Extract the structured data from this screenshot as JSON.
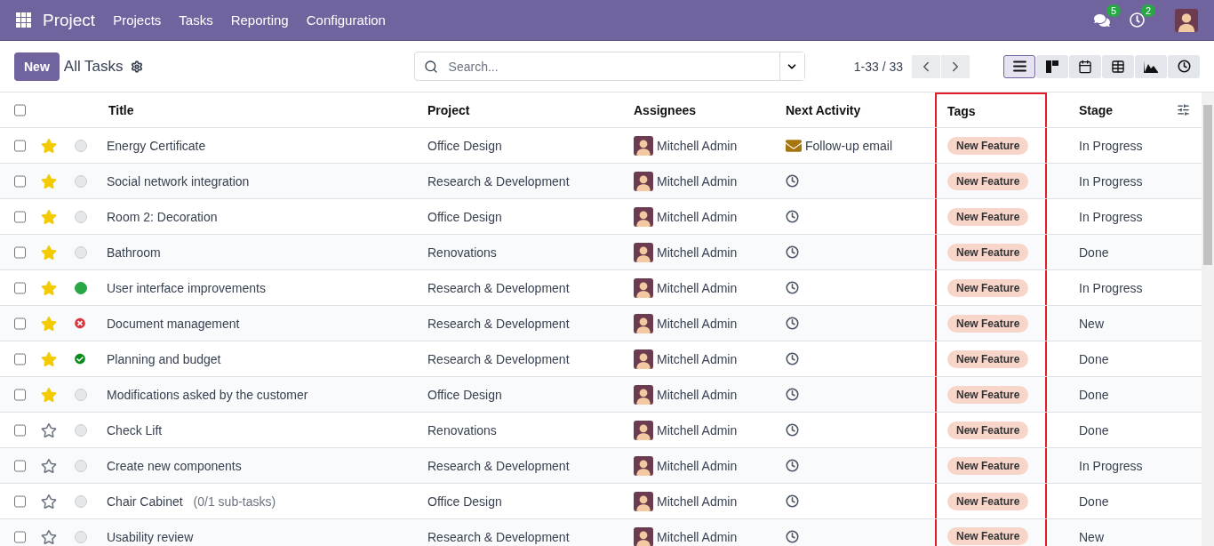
{
  "navbar": {
    "app_name": "Project",
    "menu": [
      "Projects",
      "Tasks",
      "Reporting",
      "Configuration"
    ],
    "messages_badge": "5",
    "activities_badge": "2"
  },
  "control_panel": {
    "new_button": "New",
    "title": "All Tasks",
    "search": {
      "placeholder": "Search..."
    },
    "pager": "1-33 / 33",
    "views": [
      {
        "kind": "list",
        "selected": true
      },
      {
        "kind": "kanban",
        "selected": false
      },
      {
        "kind": "calendar",
        "selected": false
      },
      {
        "kind": "pivot",
        "selected": false
      },
      {
        "kind": "graph",
        "selected": false
      },
      {
        "kind": "activity",
        "selected": false
      }
    ]
  },
  "table": {
    "all_selected": false,
    "columns": [
      {
        "label": "Title",
        "highlighted": false
      },
      {
        "label": "Project",
        "highlighted": false
      },
      {
        "label": "Assignees",
        "highlighted": false
      },
      {
        "label": "Next Activity",
        "highlighted": false
      },
      {
        "label": "Tags",
        "highlighted": true
      },
      {
        "label": "Stage",
        "highlighted": false
      }
    ],
    "rows": [
      {
        "checked": false,
        "starred": true,
        "status": {
          "kind": "normal"
        },
        "title": "Energy Certificate",
        "project": "Office Design",
        "assignee": "Mitchell Admin",
        "activity": {
          "kind": "email",
          "text": "Follow-up email"
        },
        "tag": "New Feature",
        "stage": "In Progress"
      },
      {
        "checked": false,
        "starred": true,
        "status": {
          "kind": "normal"
        },
        "title": "Social network integration",
        "project": "Research & Development",
        "assignee": "Mitchell Admin",
        "activity": {
          "kind": "none"
        },
        "tag": "New Feature",
        "stage": "In Progress"
      },
      {
        "checked": false,
        "starred": true,
        "status": {
          "kind": "normal"
        },
        "title": "Room 2: Decoration",
        "project": "Office Design",
        "assignee": "Mitchell Admin",
        "activity": {
          "kind": "none"
        },
        "tag": "New Feature",
        "stage": "In Progress"
      },
      {
        "checked": false,
        "starred": true,
        "status": {
          "kind": "normal"
        },
        "title": "Bathroom",
        "project": "Renovations",
        "assignee": "Mitchell Admin",
        "activity": {
          "kind": "none"
        },
        "tag": "New Feature",
        "stage": "Done"
      },
      {
        "checked": false,
        "starred": true,
        "status": {
          "kind": "ready"
        },
        "title": "User interface improvements",
        "project": "Research & Development",
        "assignee": "Mitchell Admin",
        "activity": {
          "kind": "none"
        },
        "tag": "New Feature",
        "stage": "In Progress"
      },
      {
        "checked": false,
        "starred": true,
        "status": {
          "kind": "blocked"
        },
        "title": "Document management",
        "project": "Research & Development",
        "assignee": "Mitchell Admin",
        "activity": {
          "kind": "none"
        },
        "tag": "New Feature",
        "stage": "New"
      },
      {
        "checked": false,
        "starred": true,
        "status": {
          "kind": "approved"
        },
        "title": "Planning and budget",
        "project": "Research & Development",
        "assignee": "Mitchell Admin",
        "activity": {
          "kind": "none"
        },
        "tag": "New Feature",
        "stage": "Done"
      },
      {
        "checked": false,
        "starred": true,
        "status": {
          "kind": "normal"
        },
        "title": "Modifications asked by the customer",
        "project": "Office Design",
        "assignee": "Mitchell Admin",
        "activity": {
          "kind": "none"
        },
        "tag": "New Feature",
        "stage": "Done"
      },
      {
        "checked": false,
        "starred": false,
        "status": {
          "kind": "normal"
        },
        "title": "Check Lift",
        "project": "Renovations",
        "assignee": "Mitchell Admin",
        "activity": {
          "kind": "none"
        },
        "tag": "New Feature",
        "stage": "Done"
      },
      {
        "checked": false,
        "starred": false,
        "status": {
          "kind": "normal"
        },
        "title": "Create new components",
        "project": "Research & Development",
        "assignee": "Mitchell Admin",
        "activity": {
          "kind": "none"
        },
        "tag": "New Feature",
        "stage": "In Progress"
      },
      {
        "checked": false,
        "starred": false,
        "status": {
          "kind": "normal"
        },
        "title": "Chair Cabinet",
        "subtasks": "(0/1 sub-tasks)",
        "project": "Office Design",
        "assignee": "Mitchell Admin",
        "activity": {
          "kind": "none"
        },
        "tag": "New Feature",
        "stage": "Done"
      },
      {
        "checked": false,
        "starred": false,
        "status": {
          "kind": "normal"
        },
        "title": "Usability review",
        "project": "Research & Development",
        "assignee": "Mitchell Admin",
        "activity": {
          "kind": "none"
        },
        "tag": "New Feature",
        "stage": "New"
      }
    ]
  }
}
